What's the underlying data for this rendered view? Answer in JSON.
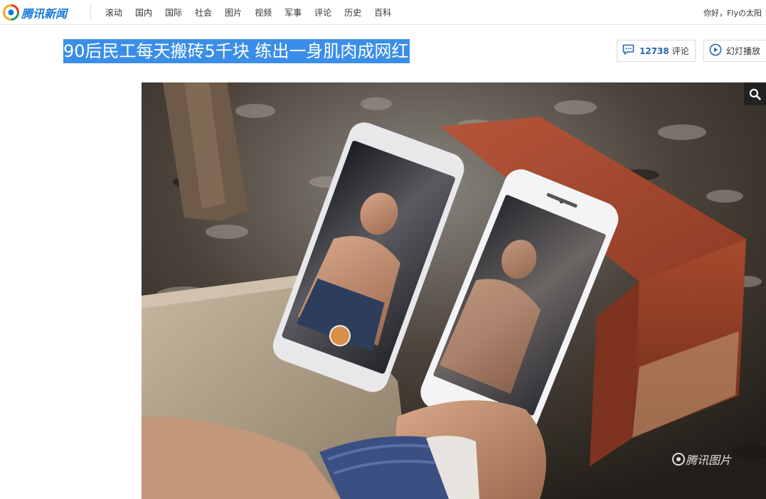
{
  "header": {
    "logo_text": "腾讯新闻",
    "nav": [
      "滚动",
      "国内",
      "国际",
      "社会",
      "图片",
      "视频",
      "军事",
      "评论",
      "历史",
      "百科"
    ],
    "greeting": "你好，Flyの太阳"
  },
  "article": {
    "title": "90后民工每天搬砖5千块 练出一身肌肉成网红",
    "comment_count": "12738",
    "comment_label": "评论",
    "slideshow_label": "幻灯播放"
  },
  "photo": {
    "watermark": "腾讯图片"
  },
  "icons": {
    "logo": "tencent-news-logo-icon",
    "comment": "comment-bubble-icon",
    "play": "play-circle-icon",
    "zoom": "magnifier-icon"
  },
  "colors": {
    "brand": "#1479d7",
    "title_highlight": "#3b8ee8",
    "comment_count": "#2a66b4"
  }
}
